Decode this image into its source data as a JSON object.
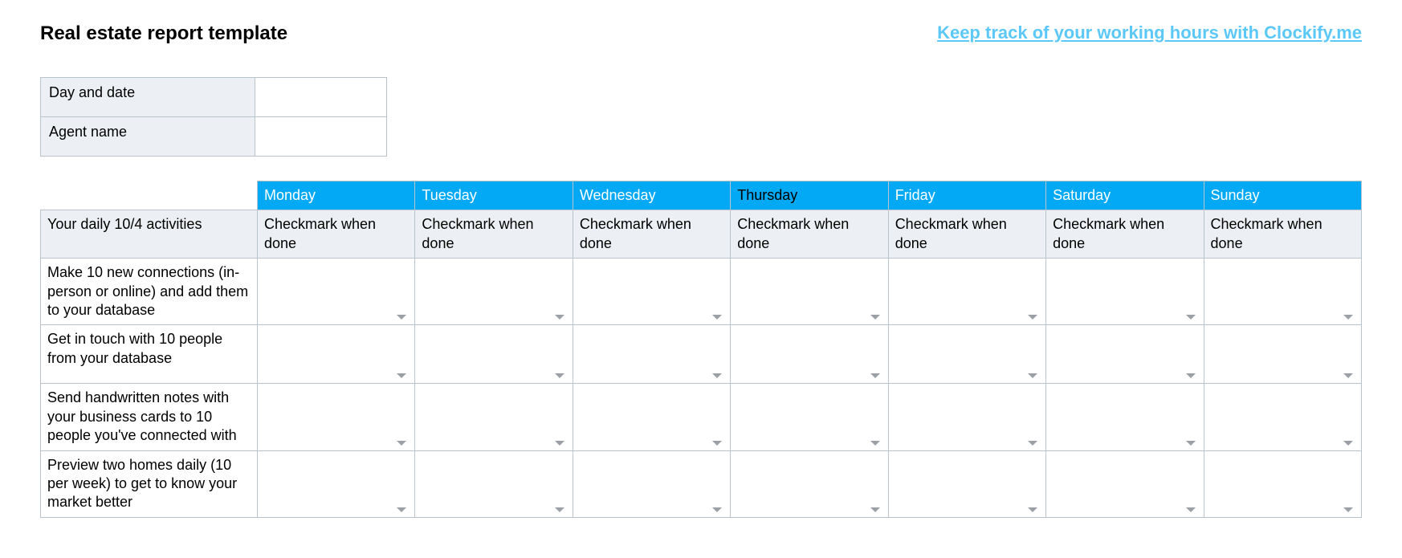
{
  "header": {
    "title": "Real estate report template",
    "promo_link_text": "Keep track of your working hours with Clockify.me"
  },
  "info": {
    "rows": [
      {
        "label": "Day and date",
        "value": ""
      },
      {
        "label": "Agent name",
        "value": ""
      }
    ]
  },
  "activities": {
    "section_label": "Your daily 10/4 activities",
    "days": [
      "Monday",
      "Tuesday",
      "Wednesday",
      "Thursday",
      "Friday",
      "Saturday",
      "Sunday"
    ],
    "sub_header": {
      "Monday": "Checkmark when done",
      "Tuesday": "Checkmark when done",
      "Wednesday": "Checkmark when done",
      "Thursday": "Checkmark when done",
      "Friday": "Checkmark when done",
      "Saturday": "Checkmark when done",
      "Sunday": "Checkmark when done"
    },
    "rows": [
      "Make 10 new connections (in-person or online) and add them to your database",
      "Get in touch with 10 people from your database",
      "Send handwritten notes with your business cards to 10 people you've connected with",
      "Preview two homes daily (10 per week) to get to know your market better"
    ]
  },
  "colors": {
    "accent": "#03a9f4",
    "link": "#5cc8f7",
    "grid": "#b9c3cc",
    "header_bg": "#eceff3"
  }
}
